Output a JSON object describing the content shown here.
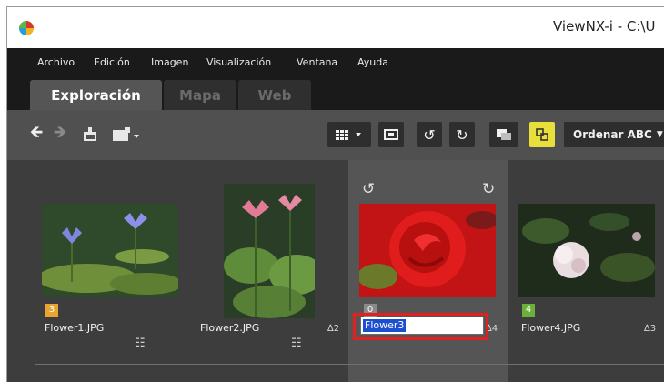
{
  "window": {
    "title": "ViewNX-i - C:\\U"
  },
  "menu": [
    "Archivo",
    "Edición",
    "Imagen",
    "Visualización",
    "Ventana",
    "Ayuda"
  ],
  "tabs": [
    {
      "label": "Exploración",
      "active": true
    },
    {
      "label": "Mapa",
      "active": false
    },
    {
      "label": "Web",
      "active": false
    }
  ],
  "toolbar": {
    "sort_label": "Ordenar ABC",
    "icons": [
      "back-arrow-icon",
      "forward-arrow-icon",
      "import-icon",
      "folder-image-icon",
      "grid-view-icon",
      "full-screen-icon",
      "rotate-left-icon",
      "rotate-right-icon",
      "compare-icon",
      "link-toggle-icon"
    ]
  },
  "thumbnails": [
    {
      "filename": "Flower1.JPG",
      "label": "3",
      "label_color": "#e8a630",
      "rating": "",
      "geotag": true
    },
    {
      "filename": "Flower2.JPG",
      "label": "",
      "label_color": "",
      "rating": "∆2",
      "geotag": true
    },
    {
      "filename": "Flower3",
      "label": "0",
      "label_color": "#8a8a8a",
      "rating": "∆4",
      "geotag": false,
      "editing": true,
      "selected": true
    },
    {
      "filename": "Flower4.JPG",
      "label": "4",
      "label_color": "#6ab03a",
      "rating": "∆3",
      "geotag": false
    }
  ],
  "colors": {
    "frame": "#2b2b2b",
    "toolbar": "#505050",
    "content": "#3d3d3d",
    "highlight": "#e32020",
    "selection": "#1c4fd0"
  }
}
